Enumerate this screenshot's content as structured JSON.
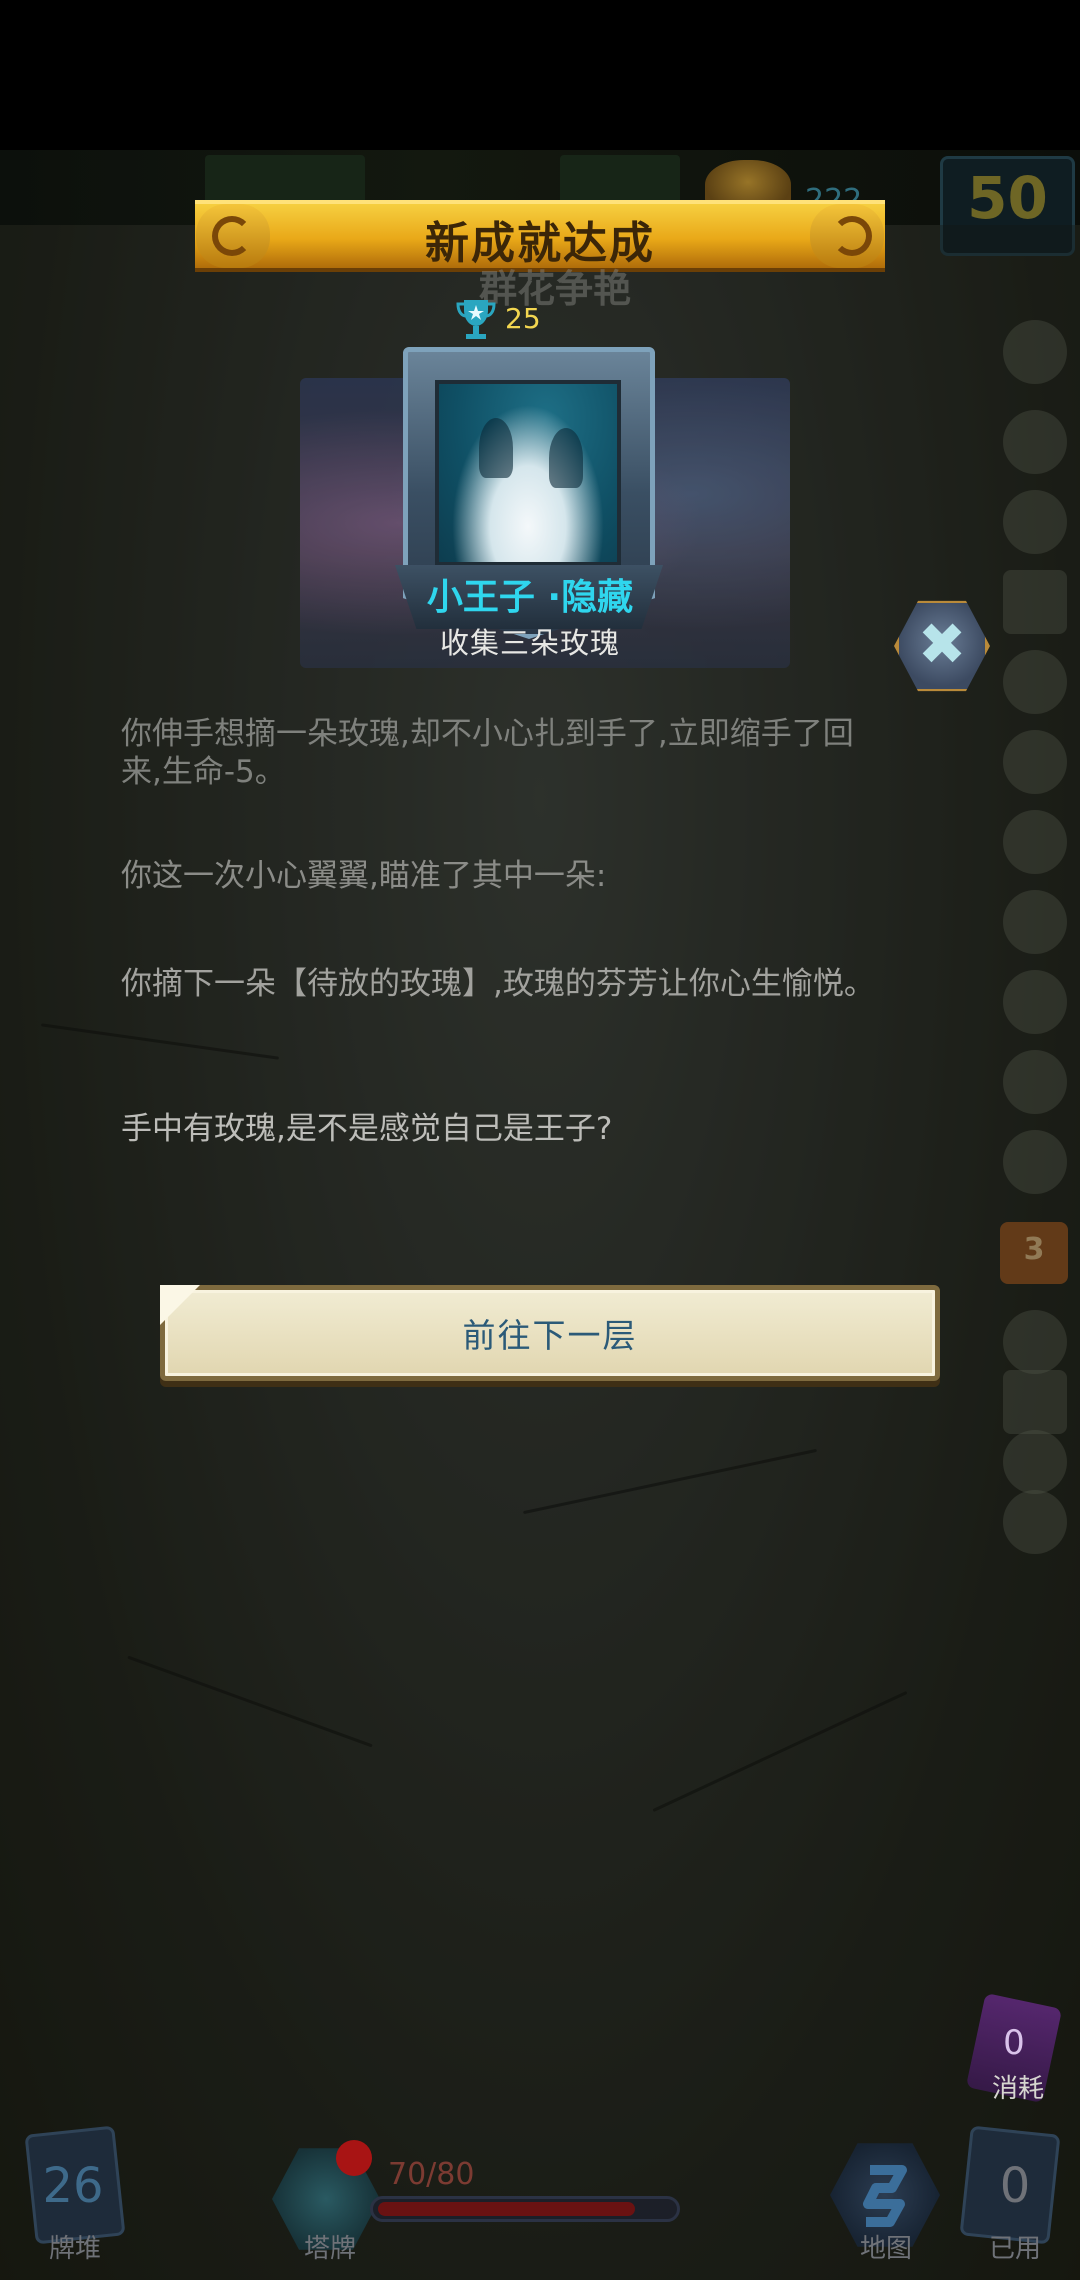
{
  "hud": {
    "gold": "222",
    "floor": "50"
  },
  "achievement": {
    "banner_title": "新成就达成",
    "background_title": "群花争艳",
    "points": "25",
    "name": "小王子 ·隐藏",
    "description": "收集三朵玫瑰"
  },
  "story": {
    "paragraph1": "你伸手想摘一朵玫瑰,却不小心扎到手了,立即缩手了回来,生命-5。",
    "paragraph2": "你这一次小心翼翼,瞄准了其中一朵:",
    "paragraph3": "你摘下一朵【待放的玫瑰】,玫瑰的芬芳让你心生愉悦。",
    "paragraph4": "手中有玫瑰,是不是感觉自己是王子?"
  },
  "actions": {
    "next_floor": "前往下一层"
  },
  "side_items": {
    "badge_count": "3"
  },
  "bottom_hud": {
    "draw_pile_count": "26",
    "draw_pile_label": "牌堆",
    "tower_label": "塔牌",
    "hp": "70/80",
    "hp_fraction": 0.875,
    "map_label": "地图",
    "used_count": "0",
    "used_label": "已用",
    "consumed_count": "0",
    "consumed_label": "消耗"
  },
  "colors": {
    "banner_gold": "#e9a818",
    "achievement_name": "#2fd6ee",
    "points": "#f2d650",
    "button_text": "#2b5a78"
  },
  "icons": {
    "trophy": "trophy-icon",
    "close": "close-icon",
    "map": "map-icon",
    "gold": "gold-pile-icon"
  }
}
